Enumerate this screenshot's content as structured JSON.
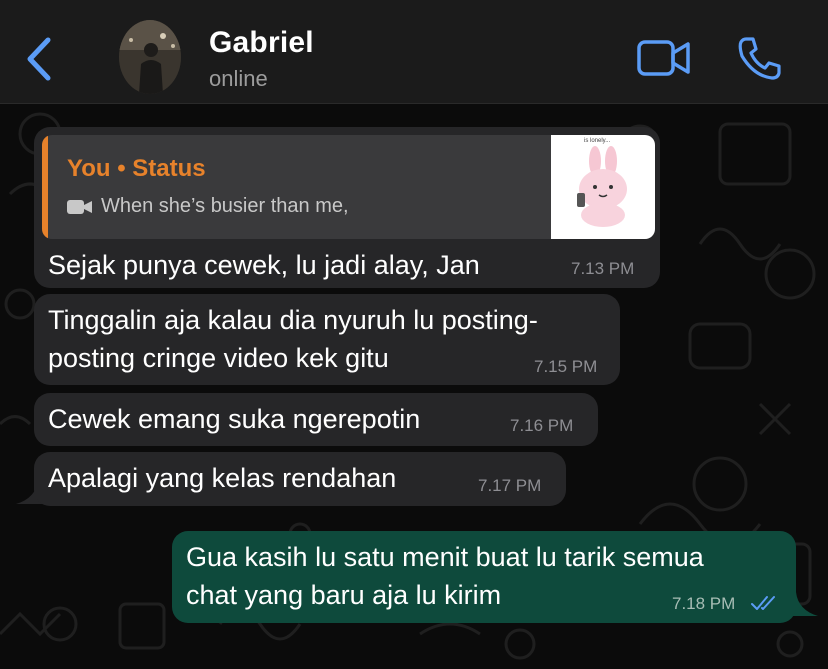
{
  "header": {
    "contact_name": "Gabriel",
    "presence": "online",
    "back_icon": "chevron-left-icon",
    "video_icon": "video-camera-icon",
    "call_icon": "phone-icon",
    "accent_color": "#5b9cf6"
  },
  "messages": [
    {
      "direction": "incoming",
      "quote": {
        "author": "You • Status",
        "text": "When she’s busier than me,",
        "media_icon": "video-camera-icon",
        "thumbnail_caption": "is lonely...",
        "accent_color": "#e7822b"
      },
      "text": "Sejak punya cewek, lu jadi alay, Jan",
      "time": "7.13 PM"
    },
    {
      "direction": "incoming",
      "text_lines": [
        "Tinggalin aja kalau dia nyuruh lu posting-",
        "posting cringe video kek gitu"
      ],
      "time": "7.15 PM"
    },
    {
      "direction": "incoming",
      "text": "Cewek emang suka ngerepotin",
      "time": "7.16 PM"
    },
    {
      "direction": "incoming",
      "text": "Apalagi yang kelas rendahan",
      "time": "7.17 PM"
    },
    {
      "direction": "outgoing",
      "text_lines": [
        "Gua kasih lu satu menit buat lu tarik semua",
        "chat yang baru aja lu kirim"
      ],
      "time": "7.18 PM",
      "status_icon": "double-check-read-icon",
      "status_color": "#5b9cf6"
    }
  ]
}
